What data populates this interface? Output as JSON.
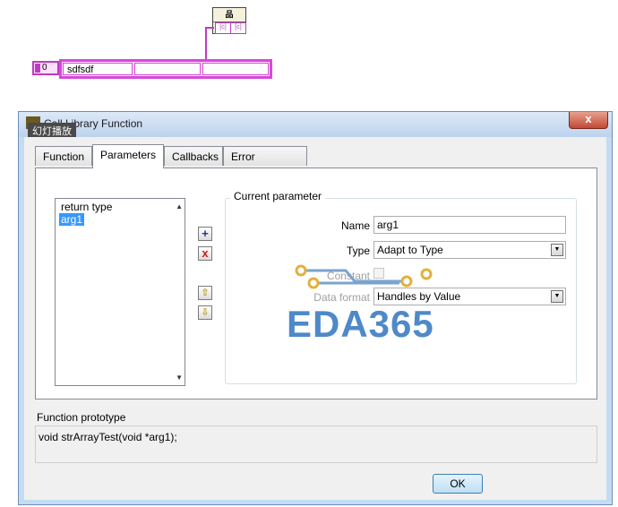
{
  "diagram": {
    "node_header": "品",
    "node_left_pin": "[c]",
    "node_right_pin": "[c]",
    "index_value": "0",
    "array_cell_0": "sdfsdf"
  },
  "dialog": {
    "title": "Call Library Function",
    "overlay_label": "幻灯播放",
    "close_glyph": "x",
    "tabs": [
      {
        "label": "Function"
      },
      {
        "label": "Parameters"
      },
      {
        "label": "Callbacks"
      },
      {
        "label": "Error Checking"
      }
    ],
    "list_items": [
      "return type",
      "arg1"
    ],
    "add_glyph": "+",
    "delete_glyph": "x",
    "up_glyph": "⇧",
    "down_glyph": "⇩",
    "group_title": "Current parameter",
    "name_label": "Name",
    "name_value": "arg1",
    "type_label": "Type",
    "type_value": "Adapt to Type",
    "constant_label": "Constant",
    "data_format_label": "Data format",
    "data_format_value": "Handles by Value",
    "prototype_label": "Function prototype",
    "prototype_value": "void  strArrayTest(void *arg1);",
    "ok_label": "OK"
  },
  "watermark": {
    "text": "EDA365"
  },
  "colors": {
    "string_wire": "#c03ac0",
    "selection": "#3399ff",
    "watermark": "#3d7dc4"
  }
}
